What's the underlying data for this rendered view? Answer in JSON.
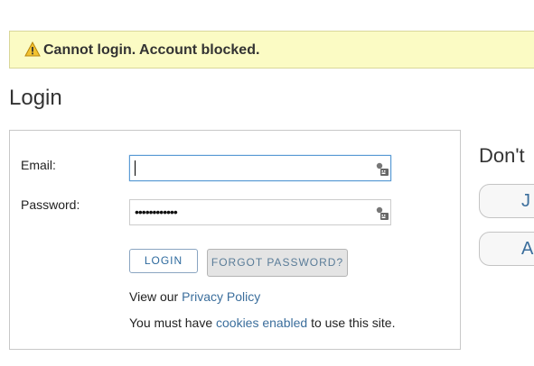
{
  "alert": {
    "icon": "warning-icon",
    "message": "Cannot login. Account blocked.",
    "background_color": "#fbfbc4",
    "icon_color": "#e0a81a"
  },
  "page": {
    "title": "Login"
  },
  "login_form": {
    "email_label": "Email:",
    "email_value": "",
    "password_label": "Password:",
    "password_value": "••••••••••••",
    "keyboard_icon": "virtual-keyboard-icon",
    "login_button": "LOGIN",
    "forgot_button": "FORGOT PASSWORD?",
    "privacy_prefix": "View our ",
    "privacy_link": "Privacy Policy",
    "cookies_prefix": "You must have ",
    "cookies_link": "cookies enabled",
    "cookies_suffix": " to use this site."
  },
  "side_panel": {
    "heading": "Don't",
    "button_1_label": "J",
    "button_2_label": "A"
  },
  "colors": {
    "link": "#3b6e9c",
    "focus_border": "#5b9bd5"
  }
}
